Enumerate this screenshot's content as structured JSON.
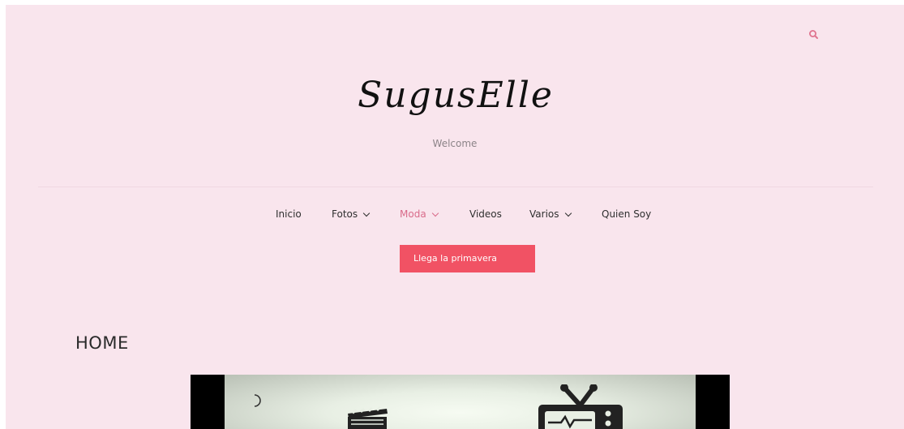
{
  "header": {
    "logo_text": "SugusElle",
    "tagline": "Welcome",
    "search_icon": "search-icon"
  },
  "nav": {
    "items": [
      {
        "label": "Inicio",
        "has_dropdown": false,
        "active": false
      },
      {
        "label": "Fotos",
        "has_dropdown": true,
        "active": false
      },
      {
        "label": "Moda",
        "has_dropdown": true,
        "active": true
      },
      {
        "label": "Videos",
        "has_dropdown": false,
        "active": false
      },
      {
        "label": "Varios",
        "has_dropdown": true,
        "active": false
      },
      {
        "label": "Quien Soy",
        "has_dropdown": false,
        "active": false
      }
    ],
    "dropdown": {
      "item_label": "Llega la primavera"
    }
  },
  "main": {
    "page_title": "HOME"
  },
  "colors": {
    "background": "#f9e5ed",
    "accent": "#f15264",
    "active_nav": "#d96b8a",
    "search_icon": "#e07590"
  },
  "video": {
    "icons": [
      "moon-icon",
      "clapperboard-icon",
      "tv-icon"
    ]
  }
}
